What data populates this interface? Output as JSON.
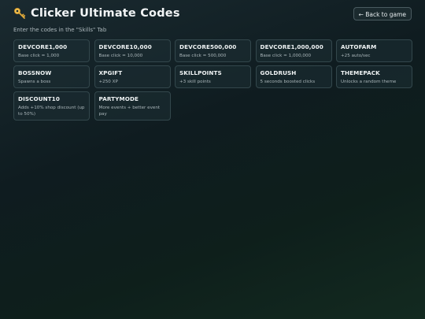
{
  "header": {
    "title": "Clicker Ultimate Codes",
    "back_label": "← Back to game",
    "icon": "key-icon"
  },
  "subtitle": "Enter the codes in the \"Skills\" Tab",
  "codes": [
    {
      "code": "DEVCORE1,000",
      "desc": "Base click = 1,000"
    },
    {
      "code": "DEVCORE10,000",
      "desc": "Base click = 10,000"
    },
    {
      "code": "DEVCORE500,000",
      "desc": "Base click = 500,000"
    },
    {
      "code": "DEVCORE1,000,000",
      "desc": "Base click = 1,000,000"
    },
    {
      "code": "AUTOFARM",
      "desc": "+25 auto/sec"
    },
    {
      "code": "BOSSNOW",
      "desc": "Spawns a boss"
    },
    {
      "code": "XPGIFT",
      "desc": "+250 XP"
    },
    {
      "code": "SKILLPOINTS",
      "desc": "+3 skill points"
    },
    {
      "code": "GOLDRUSH",
      "desc": "5 seconds boosted clicks"
    },
    {
      "code": "THEMEPACK",
      "desc": "Unlocks a random theme"
    },
    {
      "code": "DISCOUNT10",
      "desc": "Adds +10% shop discount (up to 50%)"
    },
    {
      "code": "PARTYMODE",
      "desc": "More events + better event pay"
    }
  ]
}
